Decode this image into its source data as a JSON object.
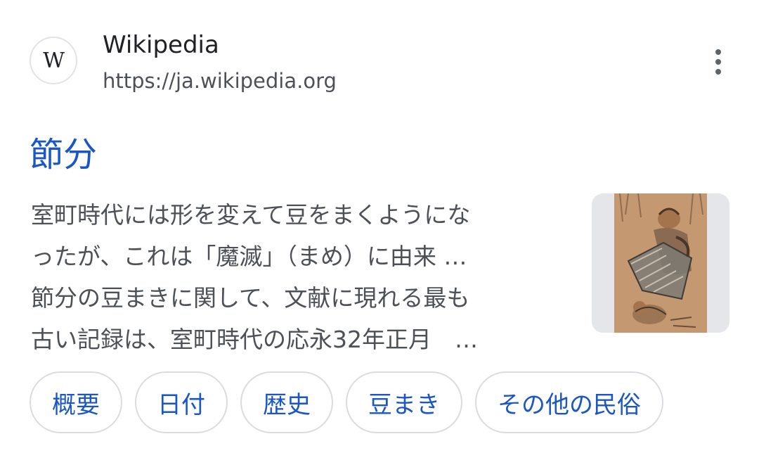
{
  "source": {
    "favicon_letter": "W",
    "name": "Wikipedia",
    "url": "https://ja.wikipedia.org",
    "more_icon": "more-vert-icon"
  },
  "result": {
    "title": "節分",
    "snippet_lines": [
      "室町時代には形を変えて豆をまくようにな",
      "ったが、これは「魔滅」（まめ）に由来 …",
      "節分の豆まきに関して、文献に現れる最も",
      "古い記録は、室町時代の応永32年正月　…"
    ],
    "thumbnail": "oni-painting-image"
  },
  "chips": [
    "概要",
    "日付",
    "歴史",
    "豆まき",
    "その他の民俗"
  ],
  "colors": {
    "link": "#1a56c4",
    "text": "#4d5156",
    "chip_border": "#dadce0"
  }
}
